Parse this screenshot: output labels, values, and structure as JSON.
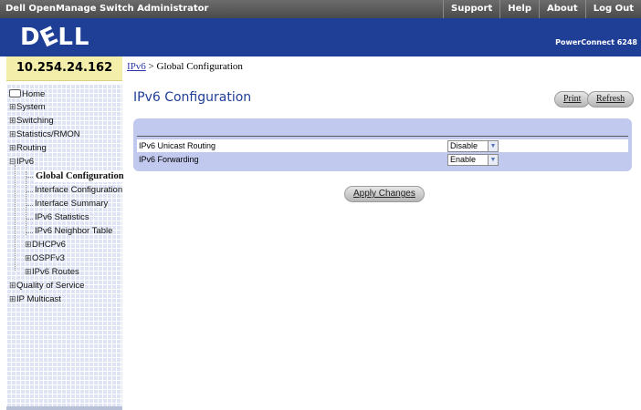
{
  "app_title": "Dell OpenManage Switch Administrator",
  "top_nav": [
    "Support",
    "Help",
    "About",
    "Log Out"
  ],
  "brand": {
    "logo": "DELL",
    "product": "PowerConnect 6248"
  },
  "ip_address": "10.254.24.162",
  "breadcrumb": {
    "link": "IPv6",
    "separator": " > ",
    "current": "Global Configuration"
  },
  "tree": {
    "home": "Home",
    "system": "System",
    "switching": "Switching",
    "statistics": "Statistics/RMON",
    "routing": "Routing",
    "ipv6": "IPv6",
    "global_config": "Global Configuration",
    "interface_config": "Interface Configuration",
    "interface_summary": "Interface Summary",
    "ipv6_statistics": "IPv6 Statistics",
    "neighbor_table": "IPv6 Neighbor Table",
    "dhcpv6": "DHCPv6",
    "ospfv3": "OSPFv3",
    "ipv6_routes": "IPv6 Routes",
    "qos": "Quality of Service",
    "ip_multicast": "IP Multicast",
    "expand_symbol": "⊞",
    "collapse_symbol": "⊟"
  },
  "main": {
    "title": "IPv6 Configuration",
    "print_label": "Print",
    "refresh_label": "Refresh",
    "rows": [
      {
        "label": "IPv6 Unicast Routing",
        "value": "Disable"
      },
      {
        "label": "IPv6 Forwarding",
        "value": "Enable"
      }
    ],
    "apply_label": "Apply Changes"
  },
  "colors": {
    "brand_blue": "#1f3e96",
    "ip_box": "#f3efab",
    "panel": "#c2c9ee",
    "tree_bg": "#dfe4f4"
  }
}
